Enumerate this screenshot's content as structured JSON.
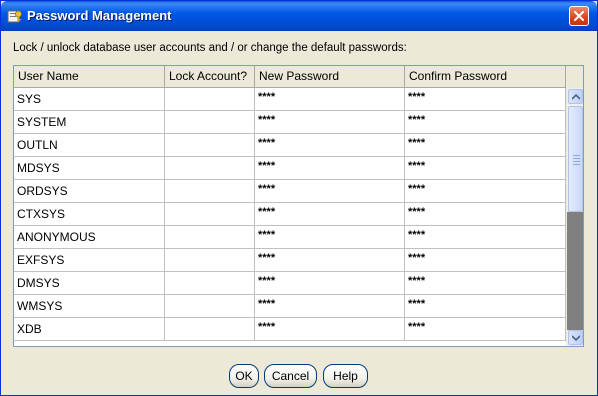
{
  "window": {
    "title": "Password Management",
    "icon": "app-key-icon",
    "close_icon": "close-icon"
  },
  "instruction": "Lock / unlock database user accounts and / or change the default passwords:",
  "table": {
    "columns": [
      "User Name",
      "Lock Account?",
      "New Password",
      "Confirm Password"
    ],
    "rows": [
      {
        "user": "SYS",
        "new_password": "****",
        "confirm_password": "****"
      },
      {
        "user": "SYSTEM",
        "new_password": "****",
        "confirm_password": "****"
      },
      {
        "user": "OUTLN",
        "new_password": "****",
        "confirm_password": "****"
      },
      {
        "user": "MDSYS",
        "new_password": "****",
        "confirm_password": "****"
      },
      {
        "user": "ORDSYS",
        "new_password": "****",
        "confirm_password": "****"
      },
      {
        "user": "CTXSYS",
        "new_password": "****",
        "confirm_password": "****"
      },
      {
        "user": "ANONYMOUS",
        "new_password": "****",
        "confirm_password": "****"
      },
      {
        "user": "EXFSYS",
        "new_password": "****",
        "confirm_password": "****"
      },
      {
        "user": "DMSYS",
        "new_password": "****",
        "confirm_password": "****"
      },
      {
        "user": "WMSYS",
        "new_password": "****",
        "confirm_password": "****"
      },
      {
        "user": "XDB",
        "new_password": "****",
        "confirm_password": "****"
      }
    ]
  },
  "buttons": {
    "ok": "OK",
    "cancel": "Cancel",
    "help": "Help"
  },
  "colors": {
    "titlebar": "#0054e3",
    "dialog_bg": "#ece9d8",
    "close_button": "#d5471a"
  }
}
